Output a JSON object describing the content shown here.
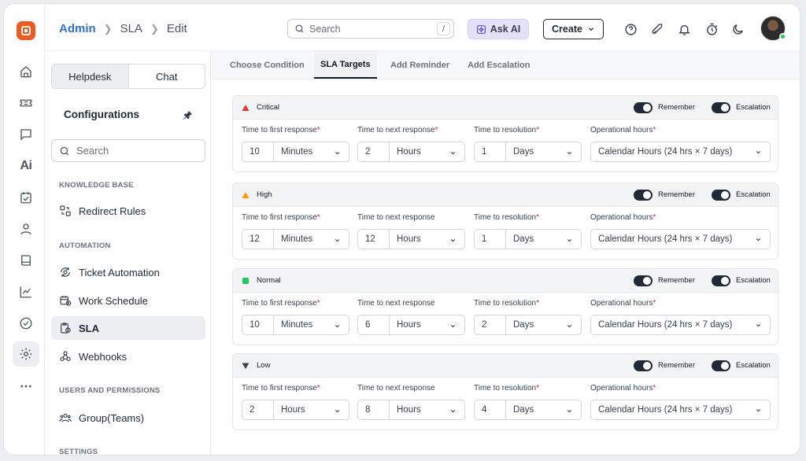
{
  "breadcrumb": [
    "Admin",
    "SLA",
    "Edit"
  ],
  "search": {
    "placeholder": "Search",
    "shortcut": "/"
  },
  "ask_ai_label": "Ask AI",
  "create_label": "Create",
  "sidebar": {
    "segments": [
      "Helpdesk",
      "Chat"
    ],
    "title": "Configurations",
    "search_placeholder": "Search",
    "sections": [
      {
        "label": "KNOWLEDGE BASE",
        "items": [
          "Redirect Rules"
        ]
      },
      {
        "label": "AUTOMATION",
        "items": [
          "Ticket Automation",
          "Work Schedule",
          "SLA",
          "Webhooks"
        ]
      },
      {
        "label": "USERS AND PERMISSIONS",
        "items": [
          "Group(Teams)"
        ]
      },
      {
        "label": "SETTINGS",
        "items": []
      }
    ],
    "active_item": "SLA"
  },
  "tabs": [
    "Choose Condition",
    "SLA Targets",
    "Add Reminder",
    "Add Escalation"
  ],
  "active_tab": "SLA Targets",
  "field_labels": {
    "first_response": "Time to first response",
    "next_response": "Time to next response",
    "resolution": "Time to resolution",
    "operational": "Operational hours"
  },
  "toggle_labels": {
    "remember": "Remember",
    "escalation": "Escalation"
  },
  "priorities": [
    {
      "name": "Critical",
      "color": "#e53935",
      "icon": "triangle-up",
      "next_required": true,
      "first": {
        "value": "10",
        "unit": "Minutes"
      },
      "next": {
        "value": "2",
        "unit": "Hours"
      },
      "resolution": {
        "value": "1",
        "unit": "Days"
      },
      "operational": "Calendar Hours (24 hrs × 7 days)",
      "remember": true,
      "escalation": true
    },
    {
      "name": "High",
      "color": "#f59e0b",
      "icon": "triangle-up",
      "next_required": false,
      "first": {
        "value": "12",
        "unit": "Minutes"
      },
      "next": {
        "value": "12",
        "unit": "Hours"
      },
      "resolution": {
        "value": "1",
        "unit": "Days"
      },
      "operational": "Calendar Hours (24 hrs × 7 days)",
      "remember": true,
      "escalation": true
    },
    {
      "name": "Normal",
      "color": "#22c55e",
      "icon": "square",
      "next_required": false,
      "first": {
        "value": "10",
        "unit": "Minutes"
      },
      "next": {
        "value": "6",
        "unit": "Hours"
      },
      "resolution": {
        "value": "2",
        "unit": "Days"
      },
      "operational": "Calendar Hours (24 hrs × 7 days)",
      "remember": true,
      "escalation": true
    },
    {
      "name": "Low",
      "color": "#374151",
      "icon": "triangle-down",
      "next_required": false,
      "first": {
        "value": "2",
        "unit": "Hours"
      },
      "next": {
        "value": "8",
        "unit": "Hours"
      },
      "resolution": {
        "value": "4",
        "unit": "Days"
      },
      "operational": "Calendar Hours (24 hrs × 7 days)",
      "remember": true,
      "escalation": true
    }
  ]
}
